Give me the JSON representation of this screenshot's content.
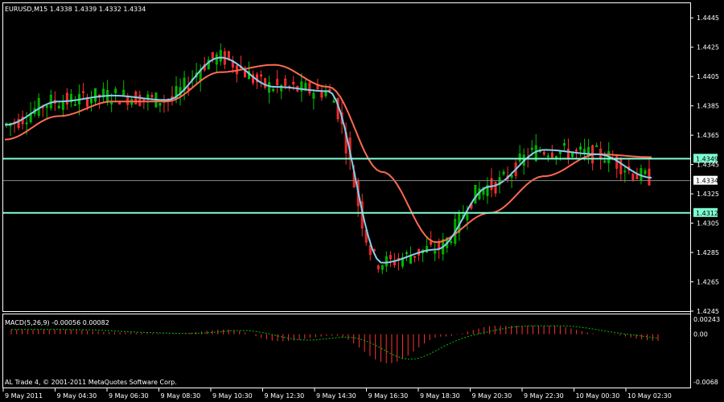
{
  "header": {
    "symbol_info": "EURUSD,M15  1.4338 1.4339 1.4332 1.4334"
  },
  "indicator": {
    "label": "MACD(5,26,9) -0.00056 0.00082",
    "axis_labels": [
      "0.00243",
      "0.00",
      "-0.0068"
    ]
  },
  "footer": {
    "copyright": "AL Trade 4, © 2001-2011 MetaQuotes Software Corp."
  },
  "price_axis": {
    "ticks": [
      "1.4445",
      "1.4425",
      "1.4405",
      "1.4385",
      "1.4365",
      "1.4345",
      "1.4325",
      "1.4305",
      "1.4285",
      "1.4265",
      "1.4245"
    ]
  },
  "price_boxes": {
    "upper_line": "1.4349",
    "current": "1.4334",
    "lower_line": "1.4312"
  },
  "time_axis": {
    "labels": [
      "9 May 2011",
      "9 May 04:30",
      "9 May 06:30",
      "9 May 08:30",
      "9 May 10:30",
      "9 May 12:30",
      "9 May 14:30",
      "9 May 16:30",
      "9 May 18:30",
      "9 May 20:30",
      "9 May 22:30",
      "10 May 00:30",
      "10 May 02:30"
    ]
  },
  "colors": {
    "bull": "#00c000",
    "bear": "#ff3030",
    "ma_fast": "#87ceeb",
    "ma_slow": "#ff6a50",
    "hline": "#7fffd4",
    "grid_border": "#ffffff",
    "macd_signal": "#00c000",
    "macd_hist": "#ff3030"
  },
  "chart_data": {
    "type": "line",
    "title": "EURUSD,M15",
    "series": [
      {
        "name": "",
        "x": [
          "9 May 2011",
          "9 May 04:30",
          "9 May 06:30",
          "9 May 08:30",
          "9 May 10:30",
          "9 May 12:30",
          "9 May 14:30",
          "9 May 16:30",
          "9 May 18:30",
          "9 May 20:30",
          "9 May 22:30",
          "10 May 00:30",
          "10 May 02:30"
        ],
        "values": [
          1.4372,
          1.4388,
          1.4392,
          1.4389,
          1.4418,
          1.4398,
          1.4395,
          1.4278,
          1.4287,
          1.433,
          1.4355,
          1.4352,
          1.4336
        ]
      },
      {
        "name": "",
        "x": [
          "9 May 2011",
          "9 May 04:30",
          "9 May 06:30",
          "9 May 08:30",
          "9 May 10:30",
          "9 May 12:30",
          "9 May 14:30",
          "9 May 16:30",
          "9 May 18:30",
          "9 May 20:30",
          "9 May 22:30",
          "10 May 00:30",
          "10 May 02:30"
        ],
        "values": [
          1.4362,
          1.4378,
          1.4388,
          1.4388,
          1.4408,
          1.4413,
          1.4398,
          1.434,
          1.4292,
          1.4312,
          1.4337,
          1.4352,
          1.435
        ]
      }
    ],
    "hlines": [
      1.4349,
      1.4312
    ],
    "last_price": 1.4334,
    "ylim": [
      1.4245,
      1.4455
    ],
    "macd": {
      "label": "MACD(5,26,9)",
      "main": -0.00056,
      "signal": 0.00082,
      "ylim": [
        -0.0068,
        0.00243
      ]
    }
  }
}
